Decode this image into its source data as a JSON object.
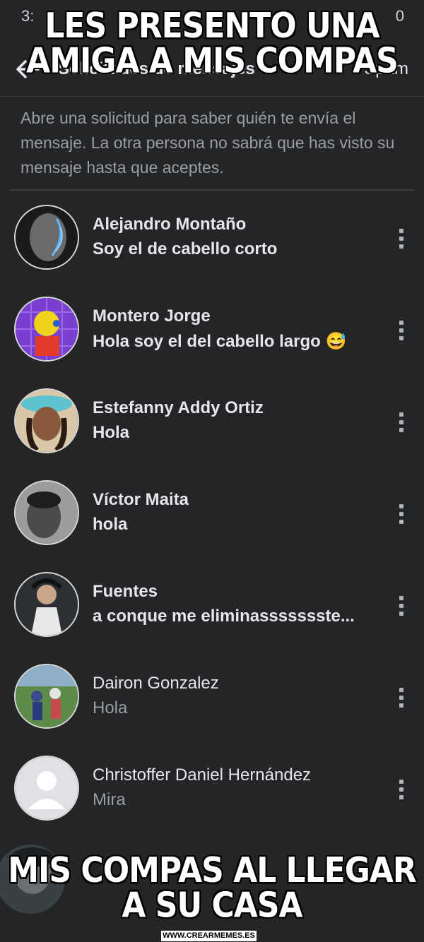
{
  "status_bar": {
    "left": "3:",
    "right": "0"
  },
  "header": {
    "title": "Solicitudes de mensajes",
    "spam_label": "Spam"
  },
  "info_text": "Abre una solicitud para saber quién te envía el mensaje. La otra persona no sabrá que has visto su mensaje hasta que aceptes.",
  "requests": [
    {
      "name": "Alejandro Montaño",
      "message": "Soy el de cabello corto",
      "unread": true
    },
    {
      "name": "Montero Jorge",
      "message": "Hola soy el del cabello largo 😅",
      "unread": true
    },
    {
      "name": "Estefanny Addy Ortiz",
      "message": "Hola",
      "unread": true
    },
    {
      "name": "Víctor Maita",
      "message": "hola",
      "unread": true
    },
    {
      "name": "Fuentes",
      "message": "a conque me eliminassssssste...",
      "unread": true
    },
    {
      "name": "Dairon Gonzalez",
      "message": "Hola",
      "unread": false
    },
    {
      "name": "Christoffer Daniel Hernández",
      "message": "Mira",
      "unread": false
    }
  ],
  "meme": {
    "top_caption": "LES PRESENTO UNA AMIGA A MIS COMPAS",
    "bottom_caption": "MIS COMPAS AL LLEGAR A SU CASA",
    "watermark": "WWW.CREARMEMES.ES"
  },
  "colors": {
    "background": "#242526",
    "text": "#e4e6eb",
    "muted": "#9a9da3"
  }
}
